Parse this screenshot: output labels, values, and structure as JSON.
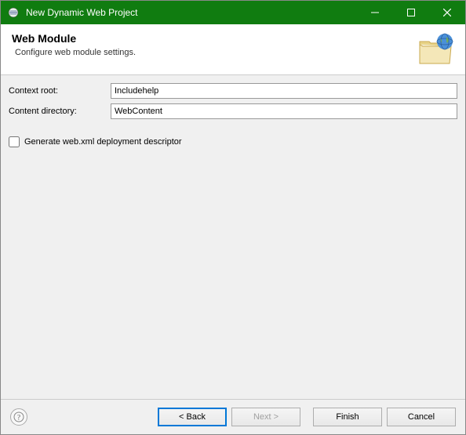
{
  "title": "New Dynamic Web Project",
  "header": {
    "title": "Web Module",
    "subtitle": "Configure web module settings."
  },
  "form": {
    "context_root_label": "Context root:",
    "context_root_value": "Includehelp",
    "content_dir_label": "Content directory:",
    "content_dir_value": "WebContent",
    "generate_webxml_label": "Generate web.xml deployment descriptor"
  },
  "buttons": {
    "back": "< Back",
    "next": "Next >",
    "finish": "Finish",
    "cancel": "Cancel"
  }
}
